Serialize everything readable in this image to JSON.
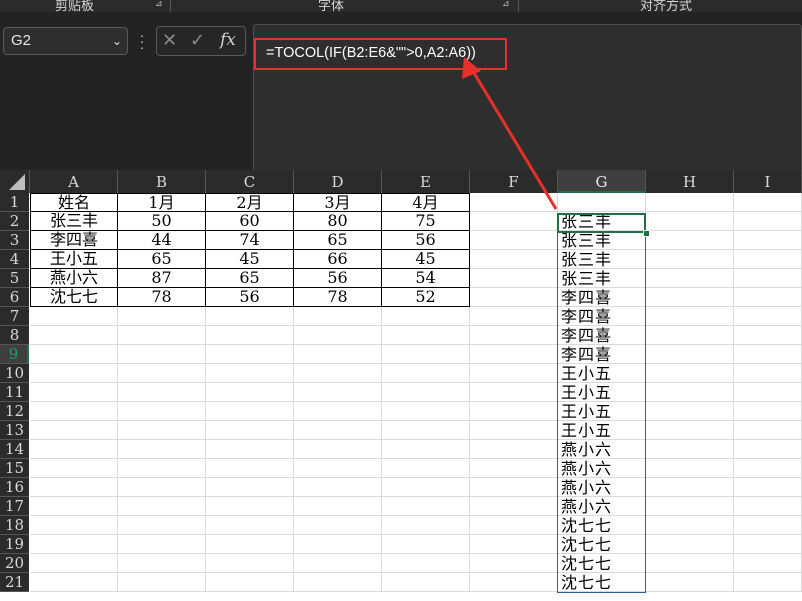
{
  "ribbon": {
    "groups": [
      {
        "label": "剪贴板"
      },
      {
        "label": "字体"
      },
      {
        "label": "对齐方式"
      }
    ],
    "launcher_icon": "dialog-launcher-icon"
  },
  "formula_bar": {
    "name_box": "G2",
    "cancel_icon": "✕",
    "enter_icon": "✓",
    "fx_label": "fx",
    "formula": "=TOCOL(IF(B2:E6&\"\">0,A2:A6))"
  },
  "columns": [
    "A",
    "B",
    "C",
    "D",
    "E",
    "F",
    "G",
    "H",
    "I"
  ],
  "rows": [
    "1",
    "2",
    "3",
    "4",
    "5",
    "6",
    "7",
    "8",
    "9",
    "10",
    "11",
    "12",
    "13",
    "14",
    "15",
    "16",
    "17",
    "18",
    "19",
    "20",
    "21"
  ],
  "selected": {
    "column": "G",
    "row": "9"
  },
  "table": {
    "header": [
      "姓名",
      "1月",
      "2月",
      "3月",
      "4月"
    ],
    "rows": [
      [
        "张三丰",
        "50",
        "60",
        "80",
        "75"
      ],
      [
        "李四喜",
        "44",
        "74",
        "65",
        "56"
      ],
      [
        "王小五",
        "65",
        "45",
        "66",
        "45"
      ],
      [
        "燕小六",
        "87",
        "65",
        "56",
        "54"
      ],
      [
        "沈七七",
        "78",
        "56",
        "78",
        "52"
      ]
    ]
  },
  "spill": [
    "张三丰",
    "张三丰",
    "张三丰",
    "张三丰",
    "李四喜",
    "李四喜",
    "李四喜",
    "李四喜",
    "王小五",
    "王小五",
    "王小五",
    "王小五",
    "燕小六",
    "燕小六",
    "燕小六",
    "燕小六",
    "沈七七",
    "沈七七",
    "沈七七",
    "沈七七"
  ],
  "colors": {
    "accent_green": "#1e7145",
    "annotation_red": "#e8302a",
    "spill_border": "#2f5fa0"
  }
}
